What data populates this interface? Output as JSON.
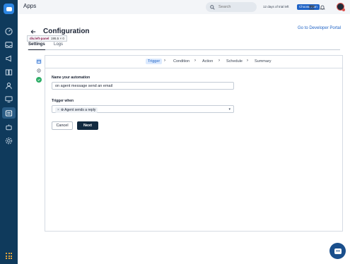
{
  "topbar": {
    "app_title": "Apps",
    "search_placeholder": "Search",
    "trial_text": "12 days of trial left",
    "plan_button": "Choose Plan"
  },
  "page": {
    "title": "Configuration",
    "developer_link": "Go to Developer Portal",
    "tooltip_name": "div.left-panel",
    "tooltip_size": "195.5 × 0",
    "tabs": [
      {
        "label": "Settings"
      },
      {
        "label": "Logs"
      }
    ]
  },
  "wizard": {
    "steps": [
      {
        "label": "Trigger"
      },
      {
        "label": "Condition"
      },
      {
        "label": "Action"
      },
      {
        "label": "Schedule"
      },
      {
        "label": "Summary"
      }
    ],
    "automation_name_label": "Name your automation",
    "automation_name_value": "on agent message send an email",
    "trigger_label": "Trigger when",
    "trigger_chip": "Agent sends a reply",
    "cancel_button": "Cancel",
    "next_button": "Next"
  },
  "colors": {
    "rail": "#0f3a5c",
    "primary": "#1f63c6",
    "next_button": "#11293f"
  }
}
